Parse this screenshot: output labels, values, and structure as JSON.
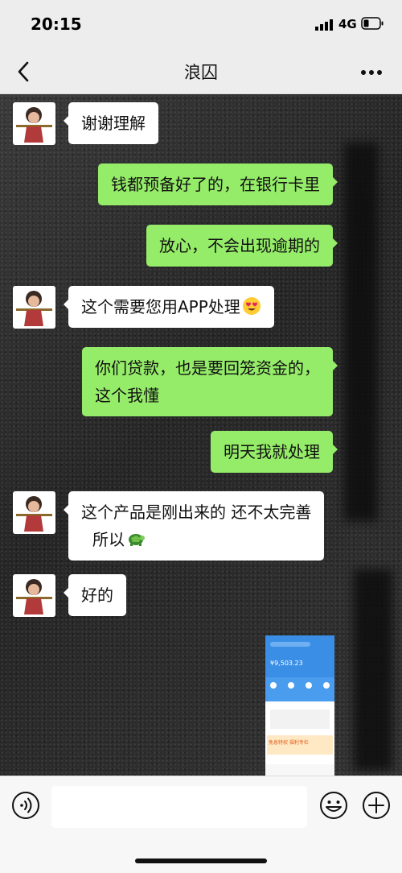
{
  "status_bar": {
    "time": "20:15",
    "network": "4G",
    "signal_icon": "cellular-signal-icon",
    "battery_icon": "battery-icon"
  },
  "nav": {
    "title": "浪囚",
    "back_icon": "chevron-left-icon",
    "more_icon": "more-dots-icon"
  },
  "messages": [
    {
      "side": "in",
      "text": "谢谢理解"
    },
    {
      "side": "out",
      "text": "钱都预备好了的，在银行卡里"
    },
    {
      "side": "out",
      "text": "放心，不会出现逾期的"
    },
    {
      "side": "in",
      "text": "这个需要您用APP处理",
      "emoji": "heart-eyes-emoji"
    },
    {
      "side": "out",
      "line1": "你们贷款，也是要回笼资金的，",
      "line2": "这个我懂"
    },
    {
      "side": "out",
      "text": "明天我就处理"
    },
    {
      "side": "in",
      "line1": "这个产品是刚出来的  还不太完善",
      "line2": "所以",
      "emoji": "turtle-emoji"
    },
    {
      "side": "in",
      "text": "好的"
    },
    {
      "side": "in",
      "type": "image",
      "image": {
        "balance": "¥9,503.23",
        "banner": "免息特权 福利专栏"
      }
    }
  ],
  "input_bar": {
    "voice_icon": "voice-icon",
    "emoji_icon": "emoji-icon",
    "plus_icon": "plus-icon"
  },
  "colors": {
    "outgoing_bubble": "#95ec69",
    "incoming_bubble": "#ffffff",
    "bar_bg": "#ededed"
  }
}
